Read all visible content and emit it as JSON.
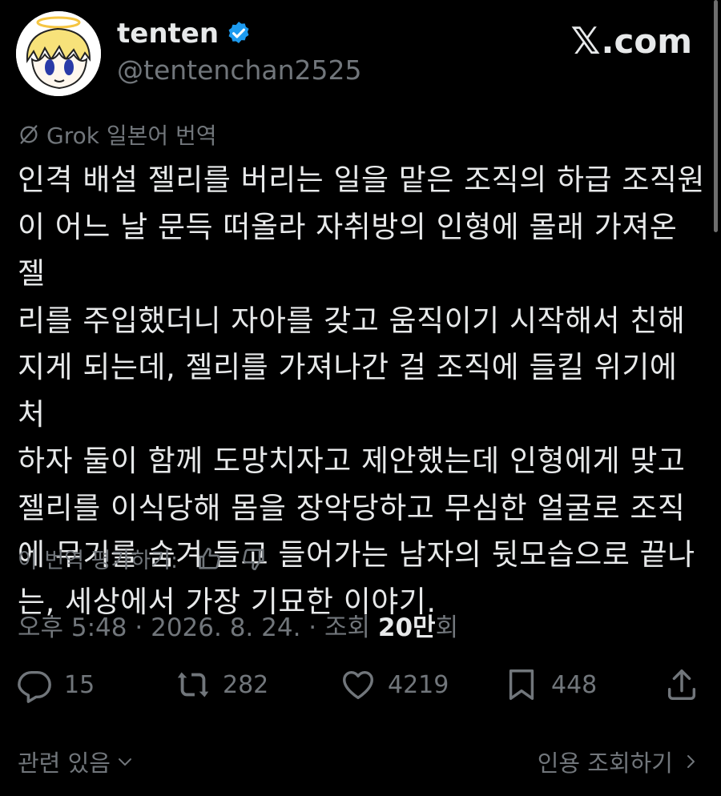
{
  "user": {
    "display_name": "tenten",
    "handle": "@tentenchan2525"
  },
  "brand": {
    "label": ".com"
  },
  "translation": {
    "label": "Grok 일본어 번역"
  },
  "tweet": {
    "text": "인격 배설 젤리를 버리는 일을 맡은 조직의 하급 조직원\n이 어느 날 문득 떠올라 자취방의 인형에 몰래 가져온 젤\n리를 주입했더니 자아를 갖고 움직이기 시작해서 친해\n지게 되는데, 젤리를 가져나간 걸 조직에 들킬 위기에 처\n하자 둘이 함께 도망치자고 제안했는데 인형에게 맞고\n젤리를 이식당해 몸을 장악당하고 무심한 얼굴로 조직\n에 무기를 숨겨 들고 들어가는 남자의 뒷모습으로 끝나\n는, 세상에서 가장 기묘한 이야기."
  },
  "rating": {
    "label": "이 번역 평가하기:"
  },
  "meta": {
    "time": "오후 5:48",
    "date": "2026. 8. 24.",
    "views_label": "조회",
    "views_count": "20만",
    "views_suffix": "회",
    "separator": "·"
  },
  "actions": {
    "replies": "15",
    "reposts": "282",
    "likes": "4219",
    "bookmarks": "448"
  },
  "footer": {
    "related": "관련 있음",
    "quotes": "인용 조회하기"
  },
  "colors": {
    "background": "#000000",
    "text": "#e7e9ea",
    "secondary": "#71767b",
    "verified": "#1d9bf0"
  }
}
